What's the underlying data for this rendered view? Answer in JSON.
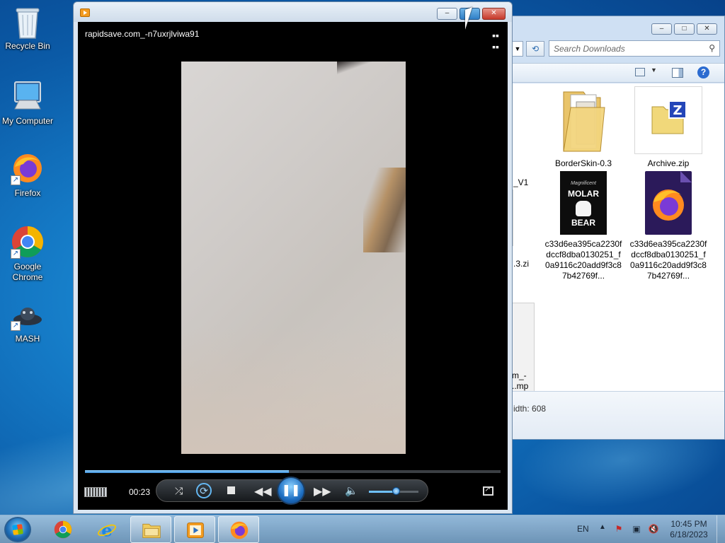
{
  "desktop": {
    "icons": [
      {
        "label": "Recycle Bin",
        "icon": "recycle-bin-icon"
      },
      {
        "label": "My Computer",
        "icon": "computer-icon"
      },
      {
        "label": "Firefox",
        "icon": "firefox-icon"
      },
      {
        "label": "Google Chrome",
        "icon": "chrome-icon"
      },
      {
        "label": "MASH",
        "icon": "mash-icon"
      }
    ]
  },
  "explorer": {
    "search_placeholder": "Search Downloads",
    "files": [
      {
        "label": "_V1",
        "icon": "file-icon"
      },
      {
        "label": "BorderSkin-0.3",
        "icon": "folder-icon"
      },
      {
        "label": "Archive.zip",
        "icon": "zip-archive-icon"
      },
      {
        "label": ".3.zi",
        "icon": "file-icon"
      },
      {
        "label": "c33d6ea395ca2230fdccf8dba0130251_f0a9116c20add9f3c87b42769f...",
        "icon": "molar-bear-image-icon"
      },
      {
        "label": "c33d6ea395ca2230fdccf8dba0130251_f0a9116c20add9f3c87b42769f...",
        "icon": "firefox-document-icon"
      },
      {
        "label": "m_-\n..mp",
        "icon": "video-file-icon"
      }
    ],
    "details_text": "idth: 608",
    "thumb_text": {
      "molar_top": "MOLAR",
      "molar_bottom": "BEAR",
      "molar_script": "Magnificent"
    }
  },
  "media_player": {
    "file_title": "rapidsave.com_-n7uxrjlviwa91",
    "elapsed": "00:23",
    "seek_progress": 0.49,
    "volume_level": 0.55,
    "accent_color": "#3e8fd8"
  },
  "taskbar": {
    "pinned": [
      {
        "name": "chrome",
        "icon": "chrome-icon"
      },
      {
        "name": "internet-explorer",
        "icon": "internet-explorer-icon"
      },
      {
        "name": "explorer",
        "icon": "folder-icon"
      },
      {
        "name": "media-player",
        "icon": "media-player-icon"
      },
      {
        "name": "firefox",
        "icon": "firefox-icon"
      }
    ],
    "language": "EN",
    "time": "10:45 PM",
    "date": "6/18/2023"
  }
}
